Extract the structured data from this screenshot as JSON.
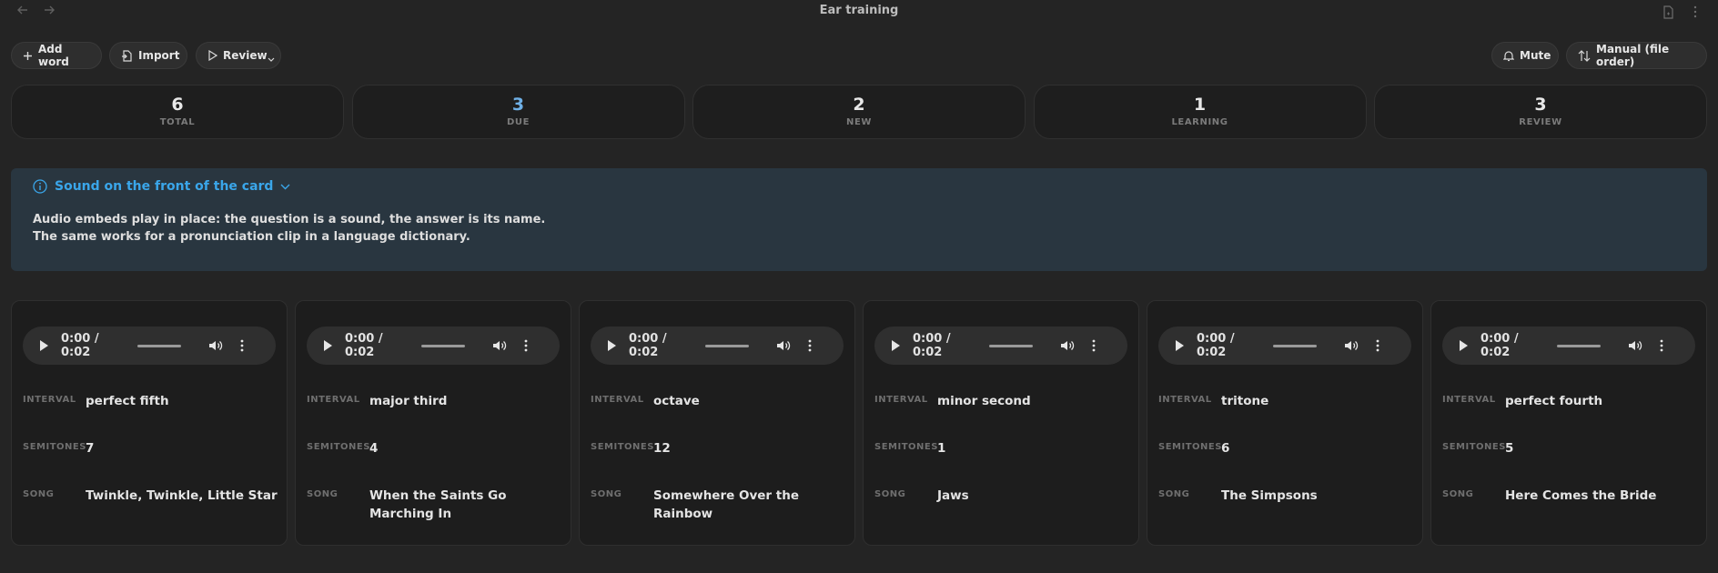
{
  "app": {
    "title": "Ear training"
  },
  "toolbar": {
    "add_word": "Add word",
    "import": "Import",
    "review": "Review",
    "mute": "Mute",
    "sort": "Manual (file order)"
  },
  "stats": [
    {
      "value": "6",
      "label": "TOTAL"
    },
    {
      "value": "3",
      "label": "DUE"
    },
    {
      "value": "2",
      "label": "NEW"
    },
    {
      "value": "1",
      "label": "LEARNING"
    },
    {
      "value": "3",
      "label": "REVIEW"
    }
  ],
  "callout": {
    "title": "Sound on the front of the card",
    "line1": "Audio embeds play in place: the question is a sound, the answer is its name.",
    "line2": "The same works for a pronunciation clip in a language dictionary."
  },
  "field_labels": {
    "interval": "INTERVAL",
    "semitones": "SEMITONES",
    "song": "SONG"
  },
  "cards": [
    {
      "time": "0:00 / 0:02",
      "interval": "perfect fifth",
      "semitones": "7",
      "song": "Twinkle, Twinkle, Little Star"
    },
    {
      "time": "0:00 / 0:02",
      "interval": "major third",
      "semitones": "4",
      "song": "When the Saints Go Marching In"
    },
    {
      "time": "0:00 / 0:02",
      "interval": "octave",
      "semitones": "12",
      "song": "Somewhere Over the Rainbow"
    },
    {
      "time": "0:00 / 0:02",
      "interval": "minor second",
      "semitones": "1",
      "song": "Jaws"
    },
    {
      "time": "0:00 / 0:02",
      "interval": "tritone",
      "semitones": "6",
      "song": "The Simpsons"
    },
    {
      "time": "0:00 / 0:02",
      "interval": "perfect fourth",
      "semitones": "5",
      "song": "Here Comes the Bride"
    }
  ],
  "colors": {
    "accent": "#3aa6ea",
    "due": "#6fb0e6",
    "callout_bg": "#293640"
  },
  "icons": [
    "back-arrow-icon",
    "forward-arrow-icon",
    "document-icon",
    "more-vertical-icon",
    "plus-icon",
    "import-icon",
    "play-icon",
    "chevron-down-icon",
    "bell-icon",
    "sort-icon",
    "info-icon",
    "volume-icon"
  ]
}
